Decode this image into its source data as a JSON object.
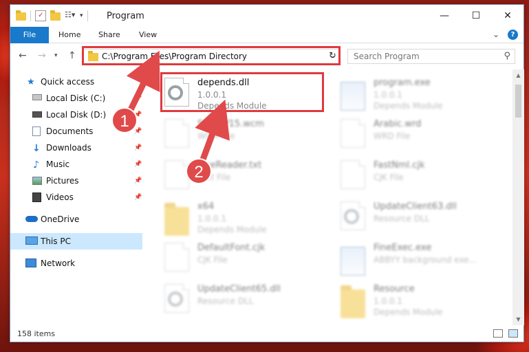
{
  "window": {
    "title": "Program"
  },
  "ribbon": {
    "tabs": [
      "File",
      "Home",
      "Share",
      "View"
    ]
  },
  "address_bar": {
    "path": "C:\\Program Files\\Program Directory"
  },
  "search": {
    "placeholder": "Search Program"
  },
  "sidebar": {
    "items": [
      {
        "label": "Quick access",
        "icon": "star-icon",
        "pinned": false
      },
      {
        "label": "Local Disk (C:)",
        "icon": "drive-icon",
        "pinned": true
      },
      {
        "label": "Local Disk (D:)",
        "icon": "drive-icon",
        "pinned": true
      },
      {
        "label": "Documents",
        "icon": "documents-icon",
        "pinned": true
      },
      {
        "label": "Downloads",
        "icon": "download-icon",
        "pinned": true
      },
      {
        "label": "Music",
        "icon": "music-icon",
        "pinned": true
      },
      {
        "label": "Pictures",
        "icon": "pictures-icon",
        "pinned": true
      },
      {
        "label": "Videos",
        "icon": "videos-icon",
        "pinned": true
      },
      {
        "label": "OneDrive",
        "icon": "cloud-icon",
        "pinned": false
      },
      {
        "label": "This PC",
        "icon": "computer-icon",
        "pinned": false,
        "selected": true
      },
      {
        "label": "Network",
        "icon": "network-icon",
        "pinned": false
      }
    ]
  },
  "files": [
    {
      "name": "depends.dll",
      "line1": "1.0.0.1",
      "line2": "Depends Module",
      "icon": "gear-dll-icon",
      "highlighted": true
    },
    {
      "name": "program.exe",
      "line1": "1.0.0.1",
      "line2": "Depends Module",
      "icon": "exe-icon"
    },
    {
      "name": "SiteWP15.wcm",
      "line1": "WCM File",
      "line2": "",
      "icon": "document-icon"
    },
    {
      "name": "Arabic.wrd",
      "line1": "WRD File",
      "line2": "",
      "icon": "document-icon"
    },
    {
      "name": "FineReader.txt",
      "line1": "Text File",
      "line2": "",
      "icon": "document-icon"
    },
    {
      "name": "FastNml.cjk",
      "line1": "CJK File",
      "line2": "",
      "icon": "document-icon"
    },
    {
      "name": "x64",
      "line1": "1.0.0.1",
      "line2": "Depends Module",
      "icon": "folder-icon"
    },
    {
      "name": "UpdateClient63.dll",
      "line1": "Resource DLL",
      "line2": "",
      "icon": "gear-dll-icon"
    },
    {
      "name": "DefaultFont.cjk",
      "line1": "CJK File",
      "line2": "",
      "icon": "document-icon"
    },
    {
      "name": "FineExec.exe",
      "line1": "ABBYY background exe...",
      "line2": "",
      "icon": "exe-icon"
    },
    {
      "name": "UpdateClient65.dll",
      "line1": "Resource DLL",
      "line2": "",
      "icon": "gear-dll-icon"
    },
    {
      "name": "Resource",
      "line1": "1.0.0.1",
      "line2": "Depends Module",
      "icon": "folder-icon"
    }
  ],
  "status": {
    "item_count": "158 items"
  },
  "annotations": {
    "step1": "1",
    "step2": "2",
    "color": "#e04a4a"
  }
}
